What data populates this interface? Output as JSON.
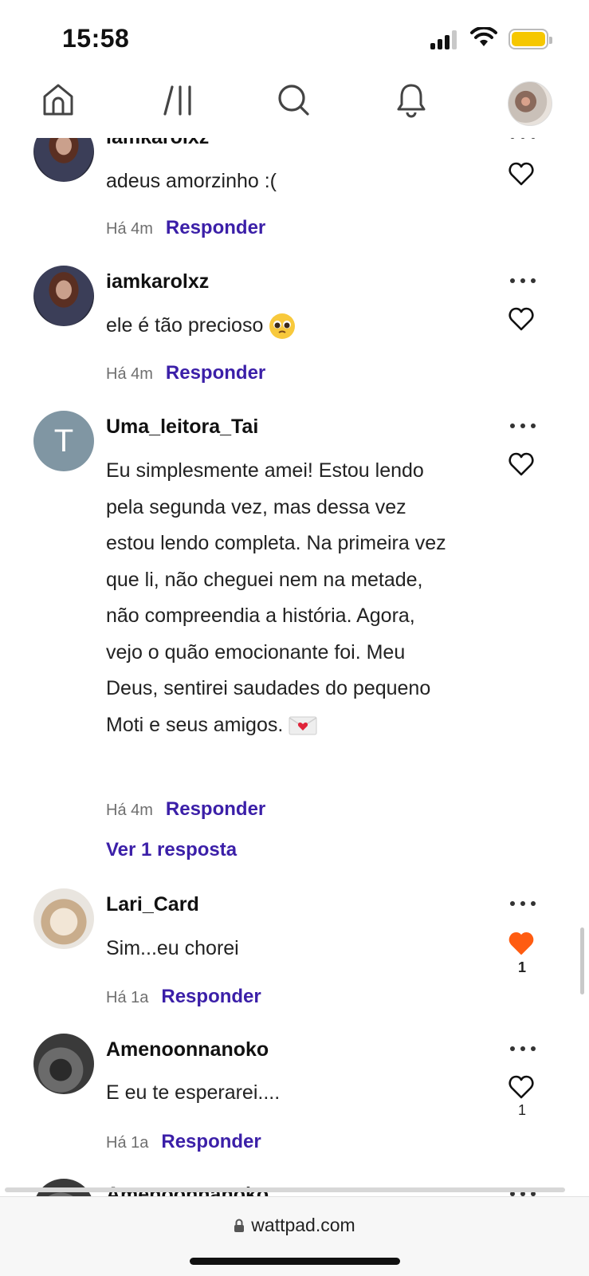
{
  "status_bar": {
    "time": "15:58"
  },
  "colors": {
    "accent_reply": "#3b1fa8",
    "liked_heart": "#ff5c11",
    "battery": "#f6c700"
  },
  "nav": {
    "items": [
      {
        "icon": "home-icon"
      },
      {
        "icon": "library-icon"
      },
      {
        "icon": "search-icon"
      },
      {
        "icon": "bell-icon"
      },
      {
        "icon": "profile-avatar"
      }
    ]
  },
  "comments": [
    {
      "username": "iamkarolxz",
      "text": "adeus amorzinho :(",
      "time": "Há 4m",
      "reply_label": "Responder",
      "likes": "",
      "liked": false
    },
    {
      "username": "iamkarolxz",
      "text": "ele é tão precioso",
      "emoji": "pleading-face-emoji",
      "time": "Há 4m",
      "reply_label": "Responder",
      "likes": "",
      "liked": false
    },
    {
      "username": "Uma_leitora_Tai",
      "avatar_letter": "T",
      "text": "Eu simplesmente amei! Estou lendo pela segunda vez, mas dessa vez estou lendo completa. Na primeira vez que li, não cheguei nem na metade, não compreendia a história. Agora, vejo o quão emocionante foi. Meu Deus, sentirei saudades do pequeno Moti e seus amigos.",
      "emoji": "love-letter-emoji",
      "time": "Há 4m",
      "reply_label": "Responder",
      "view_replies": "Ver 1 resposta",
      "likes": "",
      "liked": false
    },
    {
      "username": "Lari_Card",
      "text": "Sim...eu chorei",
      "time": "Há 1a",
      "reply_label": "Responder",
      "likes": "1",
      "liked": true
    },
    {
      "username": "Amenoonnanoko",
      "text": "E eu te esperarei....",
      "time": "Há 1a",
      "reply_label": "Responder",
      "likes": "1",
      "liked": false
    },
    {
      "username": "Amenoonnanoko"
    }
  ],
  "browser": {
    "url": "wattpad.com"
  }
}
